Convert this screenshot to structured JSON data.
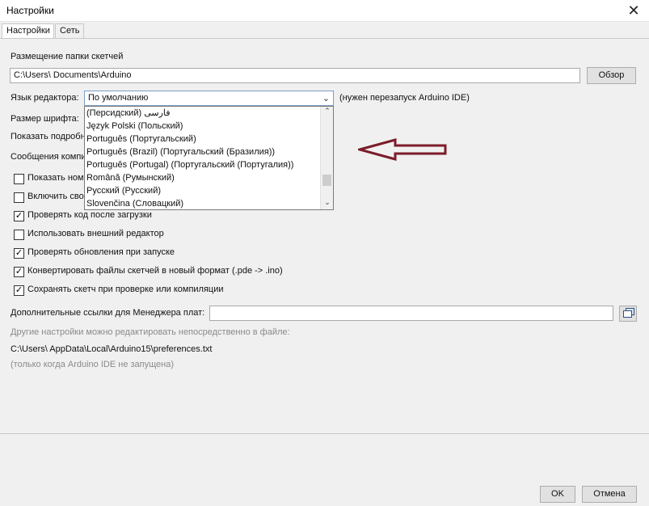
{
  "window": {
    "title": "Настройки",
    "close_glyph": "✕"
  },
  "tabs": [
    {
      "label": "Настройки",
      "active": true
    },
    {
      "label": "Сеть",
      "active": false
    }
  ],
  "sketchbook": {
    "label": "Размещение папки скетчей",
    "path": "C:\\Users\\                    Documents\\Arduino",
    "browse_label": "Обзор"
  },
  "language": {
    "label": "Язык редактора:",
    "selected": "По умолчанию",
    "note": "(нужен перезапуск Arduino IDE)",
    "options": [
      "(Персидский) فارسی",
      "Język Polski (Польский)",
      "Português (Португальский)",
      "Português (Brazil) (Португальский (Бразилия))",
      "Português (Portugal) (Португальский (Португалия))",
      "Română (Румынский)",
      "Русский (Русский)",
      "Slovenčina (Словацкий)"
    ]
  },
  "partial_labels": {
    "font_size": "Размер шрифта:",
    "verbose": "Показать подробн",
    "warnings": "Сообщения компи"
  },
  "checkboxes": [
    {
      "label": "Показать номе",
      "checked": false
    },
    {
      "label": "Включить сво",
      "checked": false
    },
    {
      "label": "Проверять код после загрузки",
      "checked": true
    },
    {
      "label": "Использовать внешний редактор",
      "checked": false
    },
    {
      "label": "Проверять обновления при запуске",
      "checked": true
    },
    {
      "label": "Конвертировать файлы скетчей в новый формат (.pde -> .ino)",
      "checked": true
    },
    {
      "label": "Сохранять скетч при проверке или компиляции",
      "checked": true
    }
  ],
  "boards_manager": {
    "label": "Дополнительные ссылки для Менеджера плат:",
    "value": ""
  },
  "prefs_info": {
    "hint": "Другие настройки можно редактировать непосредственно в файле:",
    "path": "C:\\Users\\                    AppData\\Local\\Arduino15\\preferences.txt",
    "note": "(только когда Arduino IDE не запущена)"
  },
  "footer": {
    "ok_label": "OK",
    "cancel_label": "Отмена"
  },
  "colors": {
    "arrow": "#7b1c2a",
    "checkmark": "#000000"
  },
  "icons": {
    "checked": "✓",
    "combo_arrow": "⌄",
    "scroll_up": "⌃",
    "scroll_down": "⌄"
  }
}
